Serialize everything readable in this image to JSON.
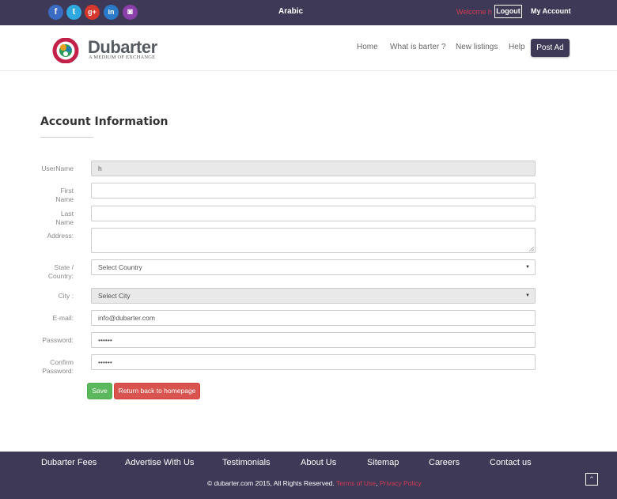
{
  "topbar": {
    "social": [
      {
        "icon": "facebook-icon",
        "glyph": "f"
      },
      {
        "icon": "twitter-icon",
        "glyph": "t"
      },
      {
        "icon": "google-plus-icon",
        "glyph": "g+"
      },
      {
        "icon": "linkedin-icon",
        "glyph": "in"
      },
      {
        "icon": "instagram-icon",
        "glyph": "◙"
      }
    ],
    "language": "Arabic",
    "welcome": "Welcome h",
    "logout": "Logout",
    "my_account": "My Account"
  },
  "header": {
    "logo_name": "Dubarter",
    "logo_tagline": "A MEDIUM OF EXCHANGE",
    "nav": [
      "Home",
      "What is barter ?",
      "New listings",
      "Help"
    ],
    "post_ad": "Post Ad"
  },
  "form": {
    "title": "Account Information",
    "fields": {
      "username": {
        "label": "UserName",
        "value": "h"
      },
      "first_name": {
        "label": "First Name",
        "value": ""
      },
      "last_name": {
        "label": "Last Name",
        "value": ""
      },
      "address": {
        "label": "Address:",
        "value": ""
      },
      "state": {
        "label": "State / Country:",
        "value": "Select Country"
      },
      "city": {
        "label": "City :",
        "value": "Select City"
      },
      "email": {
        "label": "E-mail:",
        "value": "info@dubarter.com"
      },
      "password": {
        "label": "Password:",
        "value": "••••••"
      },
      "confirm_password": {
        "label": "Confirm Password:",
        "value": "••••••"
      }
    },
    "save": "Save",
    "return": "Return back to homepage"
  },
  "footer": {
    "links": [
      "Dubarter Fees",
      "Advertise With Us",
      "Testimonials",
      "About Us",
      "Sitemap",
      "Careers",
      "Contact us"
    ],
    "copyright": "© dubarter.com 2015, All Rights Reserved.",
    "terms": "Terms of Use",
    "sep": ",",
    "privacy": "Privacy Policy",
    "to_top": "^"
  },
  "colors": {
    "brand_dark": "#3d3956",
    "accent_red": "#d33b54",
    "save_green": "#5cb85c",
    "return_red": "#d9534f"
  }
}
